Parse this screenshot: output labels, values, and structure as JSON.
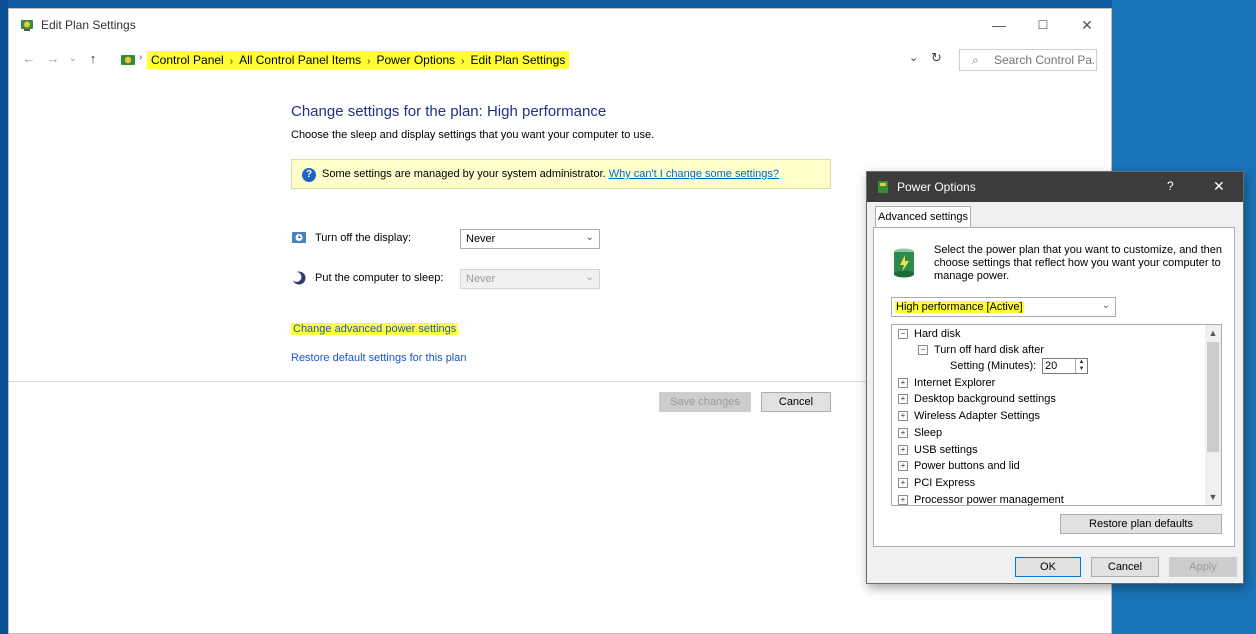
{
  "window": {
    "title": "Edit Plan Settings",
    "minimize": "—",
    "maximize": "☐",
    "close": "✕"
  },
  "nav": {
    "back": "←",
    "forward": "→",
    "recent": "⌄",
    "up": "↑"
  },
  "breadcrumb": {
    "items": [
      "Control Panel",
      "All Control Panel Items",
      "Power Options",
      "Edit Plan Settings"
    ],
    "separator": "›",
    "dropdown": "⌄",
    "refresh": "↻"
  },
  "search": {
    "placeholder": "Search Control Pa..."
  },
  "main": {
    "title": "Change settings for the plan: High performance",
    "subtitle": "Choose the sleep and display settings that you want your computer to use.",
    "info_text": "Some settings are managed by your system administrator. ",
    "info_link": "Why can't I change some settings?",
    "display_label": "Turn off the display:",
    "display_value": "Never",
    "sleep_label": "Put the computer to sleep:",
    "sleep_value": "Never",
    "advanced_link": "Change advanced power settings",
    "restore_link": "Restore default settings for this plan",
    "save_button": "Save changes",
    "cancel_button": "Cancel"
  },
  "dialog": {
    "title": "Power Options",
    "help": "?",
    "close": "✕",
    "tab": "Advanced settings",
    "description": "Select the power plan that you want to customize, and then choose settings that reflect how you want your computer to manage power.",
    "plan_value": "High performance [Active]",
    "tree": {
      "hard_disk": "Hard disk",
      "turn_off_after": "Turn off hard disk after",
      "setting_label": "Setting (Minutes):",
      "setting_value": "20",
      "items": [
        "Internet Explorer",
        "Desktop background settings",
        "Wireless Adapter Settings",
        "Sleep",
        "USB settings",
        "Power buttons and lid",
        "PCI Express",
        "Processor power management"
      ]
    },
    "restore_button": "Restore plan defaults",
    "ok": "OK",
    "cancel": "Cancel",
    "apply": "Apply"
  },
  "colors": {
    "highlight": "#ffff33",
    "link": "#1a55c7",
    "title_blue": "#1e3287",
    "desktop": "#1c6fb2"
  },
  "icons": [
    "power-options-icon",
    "clock-icon",
    "moon-icon",
    "help-icon",
    "battery-icon",
    "search-icon"
  ]
}
